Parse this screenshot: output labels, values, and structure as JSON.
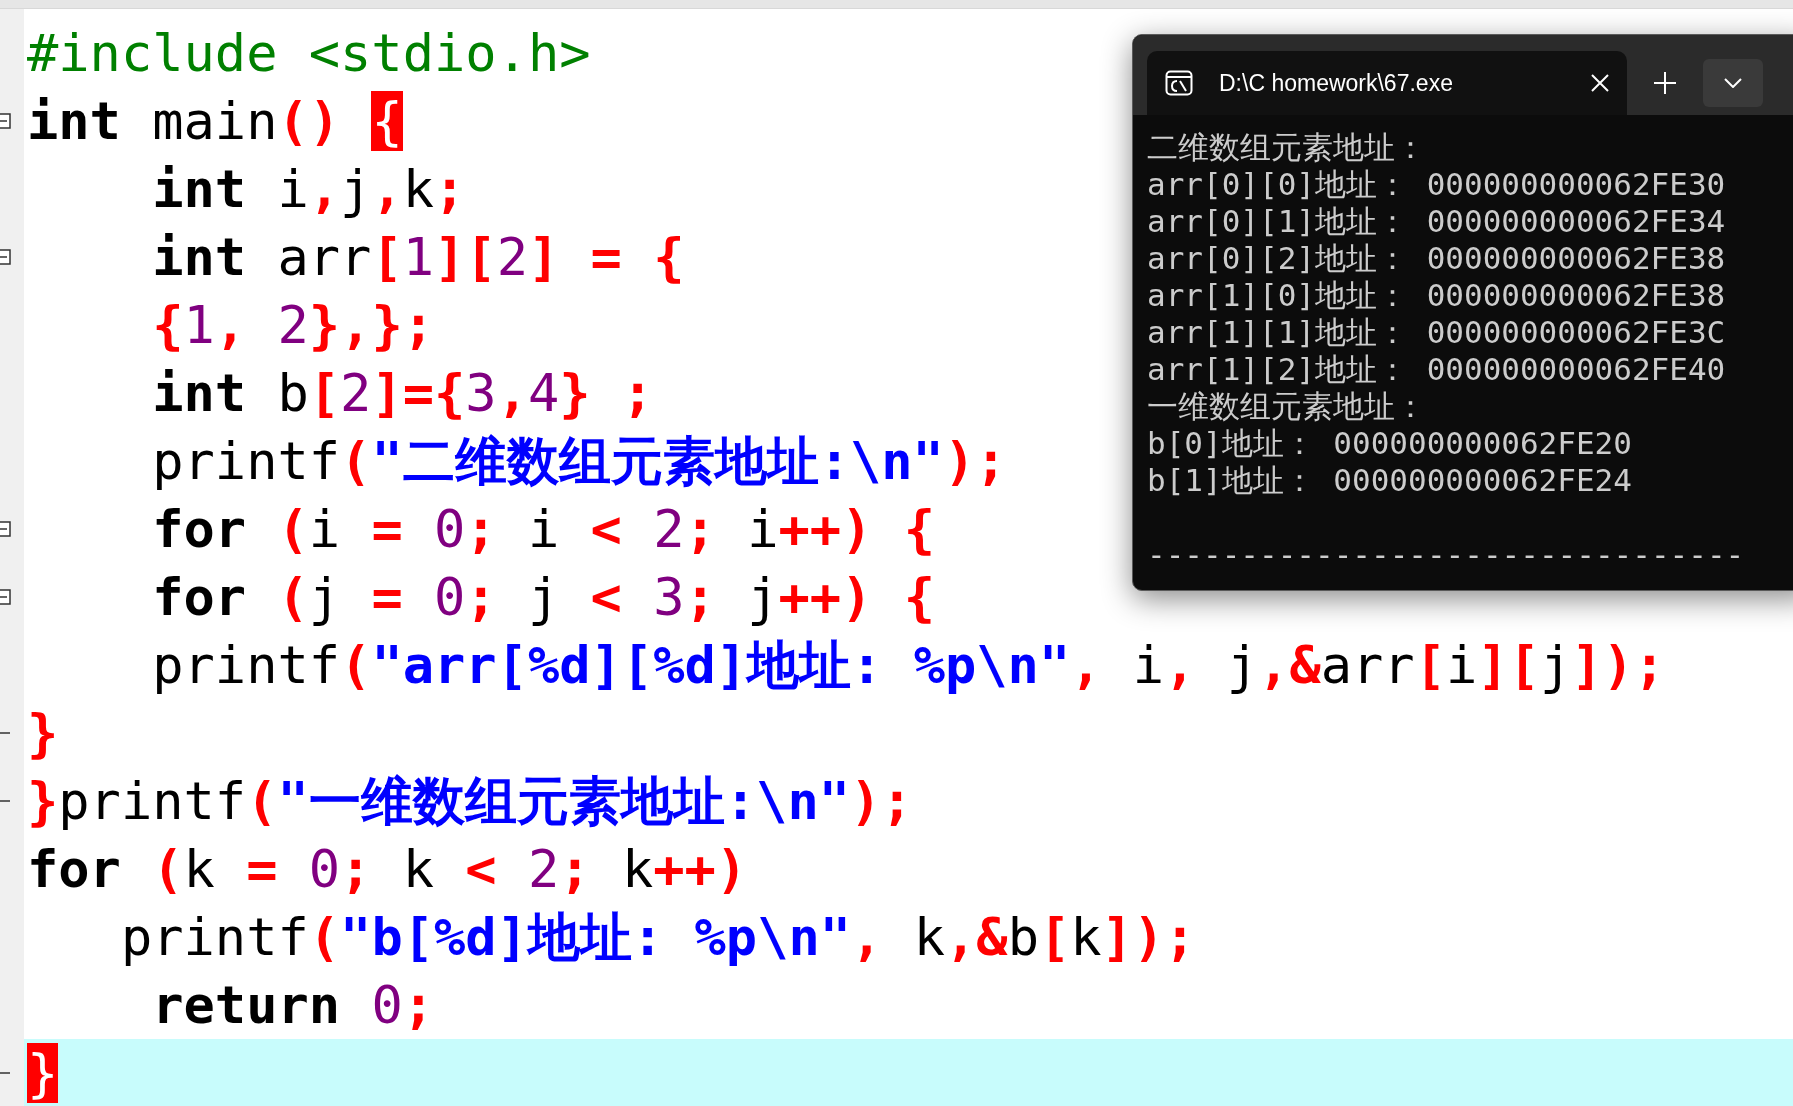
{
  "editor": {
    "lines": [
      {
        "fold_start": false,
        "fold_end": false,
        "highlighted": false,
        "tokens": [
          {
            "kind": "pp",
            "text": "#include <stdio.h>"
          }
        ]
      },
      {
        "fold_start": true,
        "fold_end": false,
        "highlighted": false,
        "tokens": [
          {
            "kind": "kw",
            "text": "int"
          },
          {
            "kind": "id",
            "text": " main"
          },
          {
            "kind": "op",
            "text": "()"
          },
          {
            "kind": "match",
            "text": " {"
          }
        ]
      },
      {
        "fold_start": false,
        "fold_end": false,
        "highlighted": false,
        "tokens": [
          {
            "kind": "kw",
            "text": "    int"
          },
          {
            "kind": "id",
            "text": " i"
          },
          {
            "kind": "op",
            "text": ","
          },
          {
            "kind": "id",
            "text": "j"
          },
          {
            "kind": "op",
            "text": ","
          },
          {
            "kind": "id",
            "text": "k"
          },
          {
            "kind": "op",
            "text": ";"
          }
        ]
      },
      {
        "fold_start": true,
        "fold_end": false,
        "highlighted": false,
        "tokens": [
          {
            "kind": "kw",
            "text": "    int"
          },
          {
            "kind": "id",
            "text": " arr"
          },
          {
            "kind": "op",
            "text": "["
          },
          {
            "kind": "num",
            "text": "1"
          },
          {
            "kind": "op",
            "text": "]["
          },
          {
            "kind": "num",
            "text": "2"
          },
          {
            "kind": "op",
            "text": "] = {"
          }
        ]
      },
      {
        "fold_start": false,
        "fold_end": false,
        "highlighted": false,
        "tokens": [
          {
            "kind": "op",
            "text": "    {"
          },
          {
            "kind": "num",
            "text": "1"
          },
          {
            "kind": "op",
            "text": ", "
          },
          {
            "kind": "num",
            "text": "2"
          },
          {
            "kind": "op",
            "text": "},};"
          }
        ]
      },
      {
        "fold_start": false,
        "fold_end": false,
        "highlighted": false,
        "tokens": [
          {
            "kind": "kw",
            "text": "    int"
          },
          {
            "kind": "id",
            "text": " b"
          },
          {
            "kind": "op",
            "text": "["
          },
          {
            "kind": "num",
            "text": "2"
          },
          {
            "kind": "op",
            "text": "]={"
          },
          {
            "kind": "num",
            "text": "3"
          },
          {
            "kind": "op",
            "text": ","
          },
          {
            "kind": "num",
            "text": "4"
          },
          {
            "kind": "op",
            "text": "} ;"
          }
        ]
      },
      {
        "fold_start": false,
        "fold_end": false,
        "highlighted": false,
        "tokens": [
          {
            "kind": "id",
            "text": "    printf"
          },
          {
            "kind": "op",
            "text": "("
          },
          {
            "kind": "str",
            "text": "\"二维数组元素地址:\\n\""
          },
          {
            "kind": "op",
            "text": ");"
          }
        ]
      },
      {
        "fold_start": true,
        "fold_end": false,
        "highlighted": false,
        "tokens": [
          {
            "kind": "kw",
            "text": "    for"
          },
          {
            "kind": "op",
            "text": " ("
          },
          {
            "kind": "id",
            "text": "i "
          },
          {
            "kind": "op",
            "text": "="
          },
          {
            "kind": "num",
            "text": " 0"
          },
          {
            "kind": "op",
            "text": ";"
          },
          {
            "kind": "id",
            "text": " i "
          },
          {
            "kind": "op",
            "text": "<"
          },
          {
            "kind": "num",
            "text": " 2"
          },
          {
            "kind": "op",
            "text": ";"
          },
          {
            "kind": "id",
            "text": " i"
          },
          {
            "kind": "op",
            "text": "++) {"
          }
        ]
      },
      {
        "fold_start": true,
        "fold_end": false,
        "highlighted": false,
        "tokens": [
          {
            "kind": "kw",
            "text": "    for"
          },
          {
            "kind": "op",
            "text": " ("
          },
          {
            "kind": "id",
            "text": "j "
          },
          {
            "kind": "op",
            "text": "="
          },
          {
            "kind": "num",
            "text": " 0"
          },
          {
            "kind": "op",
            "text": ";"
          },
          {
            "kind": "id",
            "text": " j "
          },
          {
            "kind": "op",
            "text": "<"
          },
          {
            "kind": "num",
            "text": " 3"
          },
          {
            "kind": "op",
            "text": ";"
          },
          {
            "kind": "id",
            "text": " j"
          },
          {
            "kind": "op",
            "text": "++) {"
          }
        ]
      },
      {
        "fold_start": false,
        "fold_end": false,
        "highlighted": false,
        "tokens": [
          {
            "kind": "id",
            "text": "    printf"
          },
          {
            "kind": "op",
            "text": "("
          },
          {
            "kind": "str",
            "text": "\"arr[%d][%d]地址: %p\\n\""
          },
          {
            "kind": "op",
            "text": ","
          },
          {
            "kind": "id",
            "text": " i"
          },
          {
            "kind": "op",
            "text": ","
          },
          {
            "kind": "id",
            "text": " j"
          },
          {
            "kind": "op",
            "text": ",&"
          },
          {
            "kind": "id",
            "text": "arr"
          },
          {
            "kind": "op",
            "text": "["
          },
          {
            "kind": "id",
            "text": "i"
          },
          {
            "kind": "op",
            "text": "]["
          },
          {
            "kind": "id",
            "text": "j"
          },
          {
            "kind": "op",
            "text": "]);"
          }
        ]
      },
      {
        "fold_start": false,
        "fold_end": true,
        "highlighted": false,
        "tokens": [
          {
            "kind": "op",
            "text": "}"
          }
        ]
      },
      {
        "fold_start": false,
        "fold_end": true,
        "highlighted": false,
        "tokens": [
          {
            "kind": "op",
            "text": "}"
          },
          {
            "kind": "id",
            "text": "printf"
          },
          {
            "kind": "op",
            "text": "("
          },
          {
            "kind": "str",
            "text": "\"一维数组元素地址:\\n\""
          },
          {
            "kind": "op",
            "text": ");"
          }
        ]
      },
      {
        "fold_start": false,
        "fold_end": false,
        "highlighted": false,
        "tokens": [
          {
            "kind": "kw",
            "text": "for"
          },
          {
            "kind": "op",
            "text": " ("
          },
          {
            "kind": "id",
            "text": "k "
          },
          {
            "kind": "op",
            "text": "="
          },
          {
            "kind": "num",
            "text": " 0"
          },
          {
            "kind": "op",
            "text": ";"
          },
          {
            "kind": "id",
            "text": " k "
          },
          {
            "kind": "op",
            "text": "<"
          },
          {
            "kind": "num",
            "text": " 2"
          },
          {
            "kind": "op",
            "text": ";"
          },
          {
            "kind": "id",
            "text": " k"
          },
          {
            "kind": "op",
            "text": "++)"
          }
        ]
      },
      {
        "fold_start": false,
        "fold_end": false,
        "highlighted": false,
        "tokens": [
          {
            "kind": "id",
            "text": "   printf"
          },
          {
            "kind": "op",
            "text": "("
          },
          {
            "kind": "str",
            "text": "\"b[%d]地址: %p\\n\""
          },
          {
            "kind": "op",
            "text": ","
          },
          {
            "kind": "id",
            "text": " k"
          },
          {
            "kind": "op",
            "text": ",&"
          },
          {
            "kind": "id",
            "text": "b"
          },
          {
            "kind": "op",
            "text": "["
          },
          {
            "kind": "id",
            "text": "k"
          },
          {
            "kind": "op",
            "text": "]);"
          }
        ]
      },
      {
        "fold_start": false,
        "fold_end": false,
        "highlighted": false,
        "tokens": [
          {
            "kind": "kw",
            "text": "    return"
          },
          {
            "kind": "num",
            "text": " 0"
          },
          {
            "kind": "op",
            "text": ";"
          }
        ]
      },
      {
        "fold_start": false,
        "fold_end": true,
        "highlighted": true,
        "tokens": [
          {
            "kind": "match",
            "text": "}"
          }
        ]
      }
    ]
  },
  "terminal": {
    "tab_title": "D:\\C homework\\67.exe",
    "output": [
      "二维数组元素地址：",
      "arr[0][0]地址： 000000000062FE30",
      "arr[0][1]地址： 000000000062FE34",
      "arr[0][2]地址： 000000000062FE38",
      "arr[1][0]地址： 000000000062FE38",
      "arr[1][1]地址： 000000000062FE3C",
      "arr[1][2]地址： 000000000062FE40",
      "一维数组元素地址：",
      "b[0]地址： 000000000062FE20",
      "b[1]地址： 000000000062FE24"
    ],
    "rule": "--------------------------------"
  }
}
